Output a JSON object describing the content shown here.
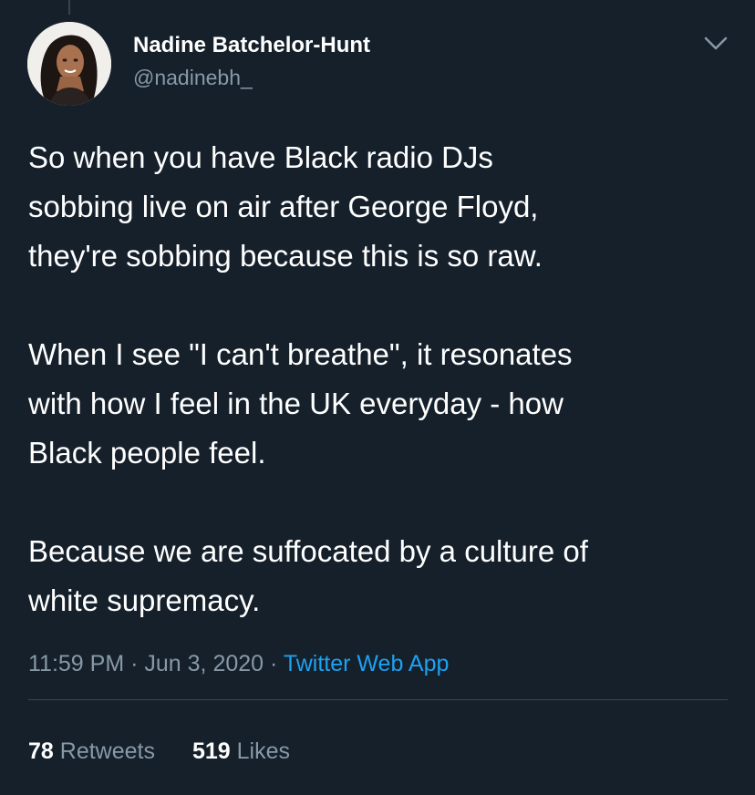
{
  "colors": {
    "background": "#15202b",
    "primary_text": "#ffffff",
    "secondary_text": "#8899a6",
    "link": "#1da1f2",
    "divider": "#38444d"
  },
  "tweet": {
    "author": {
      "name": "Nadine Batchelor-Hunt",
      "handle": "@nadinebh_",
      "avatar_icon": "profile-photo"
    },
    "menu_icon": "chevron-down-icon",
    "paragraphs": [
      {
        "lines": [
          "So when you have Black radio DJs",
          "sobbing live on air after George Floyd,",
          "they're sobbing because this is so raw."
        ]
      },
      {
        "lines": [
          "When I see \"I can't breathe\", it resonates",
          "with how I feel in the UK everyday - how",
          "Black people feel."
        ]
      },
      {
        "lines": [
          "Because we are suffocated by a culture of",
          "white supremacy."
        ]
      }
    ],
    "time": "11:59 PM",
    "date": "Jun 3, 2020",
    "source": "Twitter Web App",
    "separator": "·",
    "stats": {
      "retweets_count": "78",
      "retweets_label": "Retweets",
      "likes_count": "519",
      "likes_label": "Likes"
    }
  }
}
